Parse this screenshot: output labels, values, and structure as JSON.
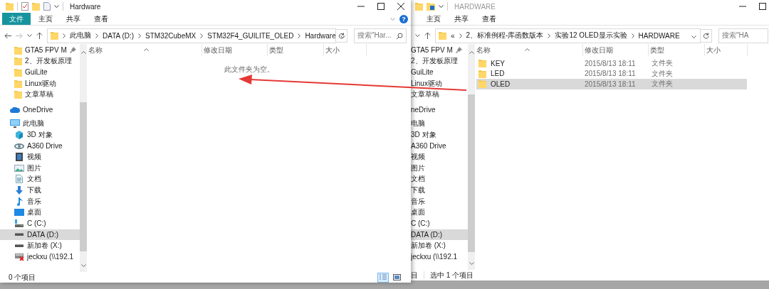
{
  "windows": [
    {
      "title": "Hardware",
      "ribbon_tabs": [
        {
          "label": "文件",
          "kind": "file"
        },
        {
          "label": "主页",
          "kind": "tab"
        },
        {
          "label": "共享",
          "kind": "tab"
        },
        {
          "label": "查看",
          "kind": "tab"
        }
      ],
      "breadcrumbs": [
        "此电脑",
        "DATA (D:)",
        "STM32CubeMX",
        "STM32F4_GUILITE_OLED",
        "Hardware"
      ],
      "search": {
        "placeholder": "搜索\"Har..."
      },
      "nav": [
        {
          "label": "GTA5 FPV M",
          "kind": "folder",
          "pinned": true,
          "selected": false
        },
        {
          "label": "2、开发板原理",
          "kind": "folder",
          "pinned": false,
          "selected": false
        },
        {
          "label": "GuiLite",
          "kind": "folder",
          "pinned": false,
          "selected": false
        },
        {
          "label": "Linux驱动",
          "kind": "folder",
          "pinned": false,
          "selected": false
        },
        {
          "label": "文章草稿",
          "kind": "folder",
          "pinned": false,
          "selected": false
        },
        {
          "label": "OneDrive",
          "kind": "cloud",
          "pinned": false,
          "selected": false
        },
        {
          "label": "此电脑",
          "kind": "pc",
          "pinned": false,
          "selected": false,
          "children": [
            {
              "label": "3D 对象",
              "kind": "cube",
              "selected": false
            },
            {
              "label": "A360 Drive",
              "kind": "a360",
              "selected": false
            },
            {
              "label": "视频",
              "kind": "video",
              "selected": false
            },
            {
              "label": "图片",
              "kind": "picture",
              "selected": false
            },
            {
              "label": "文档",
              "kind": "document",
              "selected": false
            },
            {
              "label": "下载",
              "kind": "download",
              "selected": false
            },
            {
              "label": "音乐",
              "kind": "music",
              "selected": false
            },
            {
              "label": "桌面",
              "kind": "desktop",
              "selected": false
            },
            {
              "label": "C (C:)",
              "kind": "sysdrive",
              "selected": false
            },
            {
              "label": "DATA (D:)",
              "kind": "drive",
              "selected": true
            },
            {
              "label": "新加卷 (X:)",
              "kind": "drive",
              "selected": false
            },
            {
              "label": "jeckxu (\\\\192.1",
              "kind": "netdrive",
              "selected": false
            }
          ]
        }
      ],
      "columns": [
        "名称",
        "修改日期",
        "类型",
        "大小"
      ],
      "help_button": "?",
      "empty_message": "此文件夹为空。",
      "status": [
        "0 个项目"
      ]
    },
    {
      "title": "HARDWARE",
      "ribbon_tabs": [
        {
          "label": "主页",
          "kind": "tab"
        },
        {
          "label": "共享",
          "kind": "tab"
        },
        {
          "label": "查看",
          "kind": "tab"
        }
      ],
      "breadcrumb_overflow": "«",
      "breadcrumbs": [
        "2、标准例程-库函数版本",
        "实验12 OLED显示实验",
        "HARDWARE"
      ],
      "search": {
        "placeholder": "搜索\"HA"
      },
      "nav": [
        {
          "label": "GTA5 FPV M",
          "pinned": true,
          "selected": false
        },
        {
          "label": "2、开发板原理",
          "pinned": false,
          "selected": false
        },
        {
          "label": "GuiLite",
          "pinned": false,
          "selected": false
        },
        {
          "label": "Linux驱动",
          "pinned": false,
          "selected": false
        },
        {
          "label": "文章草稿",
          "pinned": false,
          "selected": false
        },
        {
          "label": "neDrive",
          "pinned": false,
          "selected": false
        },
        {
          "label": "电脑",
          "pinned": false,
          "selected": false,
          "children": [
            {
              "label": "3D 对象",
              "selected": false
            },
            {
              "label": "A360 Drive",
              "selected": false
            },
            {
              "label": "视频",
              "selected": false
            },
            {
              "label": "图片",
              "selected": false
            },
            {
              "label": "文档",
              "selected": false
            },
            {
              "label": "下载",
              "selected": false
            },
            {
              "label": "音乐",
              "selected": false
            },
            {
              "label": "桌面",
              "selected": false
            },
            {
              "label": "C (C:)",
              "selected": false
            },
            {
              "label": "DATA (D:)",
              "selected": true
            },
            {
              "label": "新加卷 (X:)",
              "selected": false
            },
            {
              "label": "jeckxu (\\\\192.1",
              "selected": false
            }
          ]
        }
      ],
      "columns": [
        "名称",
        "修改日期",
        "类型",
        "大小"
      ],
      "files": [
        {
          "name": "KEY",
          "date": "2015/8/13 18:11",
          "type": "文件夹",
          "selected": false
        },
        {
          "name": "LED",
          "date": "2015/8/13 18:11",
          "type": "文件夹",
          "selected": false
        },
        {
          "name": "OLED",
          "date": "2015/8/13 18:11",
          "type": "文件夹",
          "selected": true
        }
      ],
      "status": [
        "目",
        "选中 1 个项目"
      ]
    }
  ]
}
